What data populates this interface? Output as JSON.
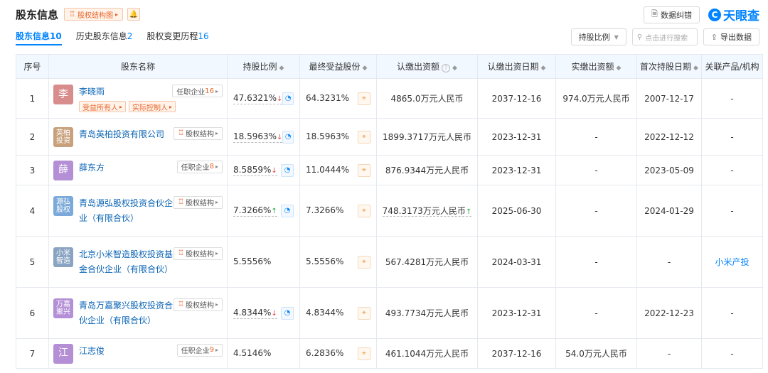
{
  "header": {
    "title": "股东信息",
    "equity_chart_label": "股权结构图",
    "error_btn": "数据纠错",
    "logo_text": "天眼查"
  },
  "tabs": [
    {
      "label": "股东信息",
      "count": "10"
    },
    {
      "label": "历史股东信息",
      "count": "2"
    },
    {
      "label": "股权变更历程",
      "count": "16"
    }
  ],
  "tools": {
    "ratio_select": "持股比例",
    "search_placeholder": "点击进行搜索",
    "export_label": "导出数据"
  },
  "columns": [
    "序号",
    "股东名称",
    "持股比例",
    "最终受益股份",
    "认缴出资额",
    "认缴出资日期",
    "实缴出资额",
    "首次持股日期",
    "关联产品/机构"
  ],
  "rows": [
    {
      "no": "1",
      "avatar": "李",
      "avatar_color": "#d98c8c",
      "name": "李晓雨",
      "pill_label": "任职企业",
      "pill_num": "16",
      "badges": [
        "受益所有人",
        "实际控制人"
      ],
      "ratio": "47.6321%",
      "trend": "down",
      "final": "64.3231%",
      "subscribed": "4865.0万元人民币",
      "sub_date": "2037-12-16",
      "paid": "974.0万元人民币",
      "first_date": "2007-12-17",
      "related": "-"
    },
    {
      "no": "2",
      "avatar": "英柏投资",
      "avatar_color": "#c8a07c",
      "name": "青岛英柏投资有限公司",
      "pill_label": "股权结构",
      "pill_num": "",
      "badges": [],
      "ratio": "18.5963%",
      "trend": "down",
      "final": "18.5963%",
      "subscribed": "1899.3717万元人民币",
      "sub_date": "2023-12-31",
      "paid": "-",
      "first_date": "2022-12-12",
      "related": "-"
    },
    {
      "no": "3",
      "avatar": "薛",
      "avatar_color": "#b48fd6",
      "name": "薛东方",
      "pill_label": "任职企业",
      "pill_num": "8",
      "badges": [],
      "ratio": "8.5859%",
      "trend": "down",
      "final": "11.0444%",
      "subscribed": "876.9344万元人民币",
      "sub_date": "2023-12-31",
      "paid": "-",
      "first_date": "2023-05-09",
      "related": "-"
    },
    {
      "no": "4",
      "avatar": "源弘股权",
      "avatar_color": "#7ba9d9",
      "name": "青岛源弘股权投资合伙企业（有限合伙）",
      "pill_label": "股权结构",
      "pill_num": "",
      "badges": [],
      "ratio": "7.3266%",
      "trend": "up",
      "final": "7.3266%",
      "subscribed": "748.3173万元人民币",
      "sub_trend": "up",
      "sub_date": "2025-06-30",
      "paid": "-",
      "first_date": "2024-01-29",
      "related": "-"
    },
    {
      "no": "5",
      "avatar": "小米智造",
      "avatar_color": "#8aa3c2",
      "name": "北京小米智造股权投资基金合伙企业（有限合伙）",
      "pill_label": "股权结构",
      "pill_num": "",
      "badges": [],
      "ratio": "5.5556%",
      "trend": "",
      "final": "5.5556%",
      "subscribed": "567.4281万元人民币",
      "sub_date": "2024-03-31",
      "paid": "-",
      "first_date": "-",
      "related": "小米产投"
    },
    {
      "no": "6",
      "avatar": "万嘉聚兴",
      "avatar_color": "#b48fd6",
      "name": "青岛万嘉聚兴股权投资合伙企业（有限合伙）",
      "pill_label": "股权结构",
      "pill_num": "",
      "badges": [],
      "ratio": "4.8344%",
      "trend": "down",
      "final": "4.8344%",
      "subscribed": "493.7734万元人民币",
      "sub_date": "2023-12-31",
      "paid": "-",
      "first_date": "2022-12-23",
      "related": "-"
    },
    {
      "no": "7",
      "avatar": "江",
      "avatar_color": "#b48fd6",
      "name": "江志俊",
      "pill_label": "任职企业",
      "pill_num": "9",
      "badges": [],
      "ratio": "4.5146%",
      "trend": "",
      "final": "6.2836%",
      "subscribed": "461.1044万元人民币",
      "sub_date": "2037-12-16",
      "paid": "54.0万元人民币",
      "first_date": "-",
      "related": "-"
    }
  ],
  "icons": {
    "chart": "org-chart-icon",
    "bell": "bell-icon",
    "error": "document-icon",
    "search": "search-icon",
    "export": "export-icon",
    "pie": "pie-chart-icon",
    "target": "target-icon"
  }
}
